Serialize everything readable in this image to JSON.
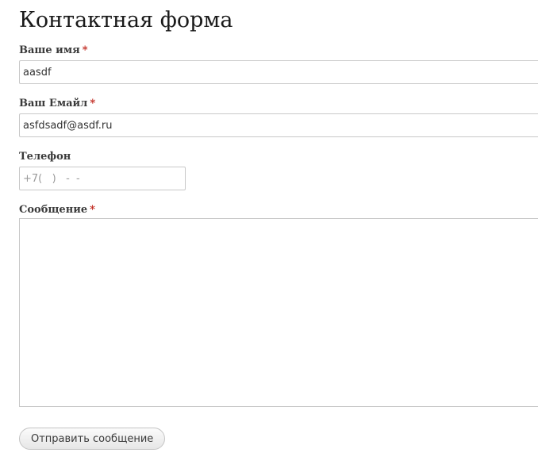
{
  "page": {
    "title": "Контактная форма"
  },
  "form": {
    "required_mark": "*",
    "name": {
      "label": "Ваше имя",
      "value": "aasdf"
    },
    "email": {
      "label": "Ваш Емайл",
      "value": "asfdsadf@asdf.ru"
    },
    "phone": {
      "label": "Телефон",
      "value": "",
      "placeholder": "+7(   )   -  -"
    },
    "message": {
      "label": "Сообщение",
      "value": ""
    },
    "submit_label": "Отправить сообщение"
  },
  "colors": {
    "required": "#c0281e",
    "border": "#c8c8c8",
    "text": "#333333"
  }
}
